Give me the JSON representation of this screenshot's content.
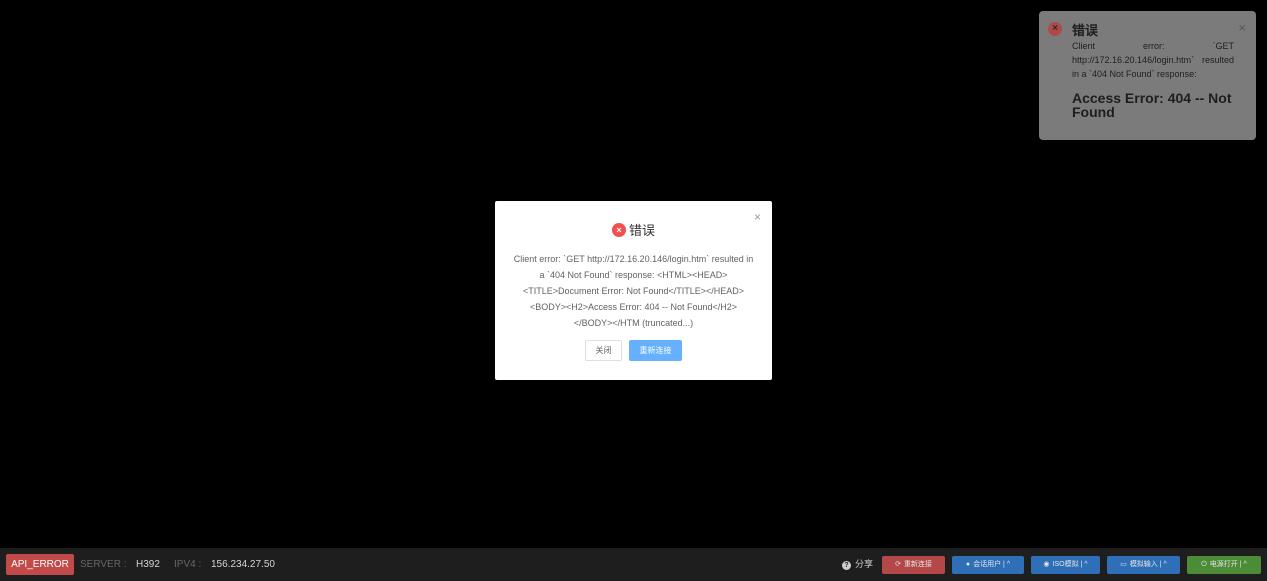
{
  "toast": {
    "title": "错误",
    "close_icon": "close-icon",
    "message": "Client error: `GET http://172.16.20.146/login.htm` resulted in a `404 Not Found` response:",
    "heading": "Access Error: 404 -- Not Found",
    "icon": "error-circle-icon",
    "icon_color": "#b04a4a"
  },
  "modal": {
    "title": "错误",
    "icon": "error-circle-icon",
    "icon_color": "#f05050",
    "close_icon": "close-icon",
    "body": "Client error: `GET http://172.16.20.146/login.htm` resulted in a `404 Not Found` response: <HTML><HEAD><TITLE>Document Error: Not Found</TITLE></HEAD><BODY><H2>Access Error: 404 -- Not Found</H2></BODY></HTM (truncated...)",
    "close_label": "关闭",
    "reconnect_label": "重新连接",
    "primary_color": "#66b1ff"
  },
  "statusbar": {
    "status_badge": "API_ERROR",
    "status_color": "#c24a4a",
    "server_label": "SERVER :",
    "server_value": "H392",
    "ipv4_label": "IPV4 :",
    "ipv4_value": "156.234.27.50",
    "share_label": "分享",
    "buttons": [
      {
        "label": "重新连接",
        "icon": "refresh-icon",
        "color": "#b44848"
      },
      {
        "label": "会话用户 | ^",
        "icon": "user-icon",
        "color": "#2f6fb7"
      },
      {
        "label": "ISO模拟 | ^",
        "icon": "disc-icon",
        "color": "#2f6fb7"
      },
      {
        "label": "模拟输入 | ^",
        "icon": "keyboard-icon",
        "color": "#2f6fb7"
      },
      {
        "label": "电源打开 | ^",
        "icon": "power-icon",
        "color": "#4d8c36"
      }
    ]
  }
}
